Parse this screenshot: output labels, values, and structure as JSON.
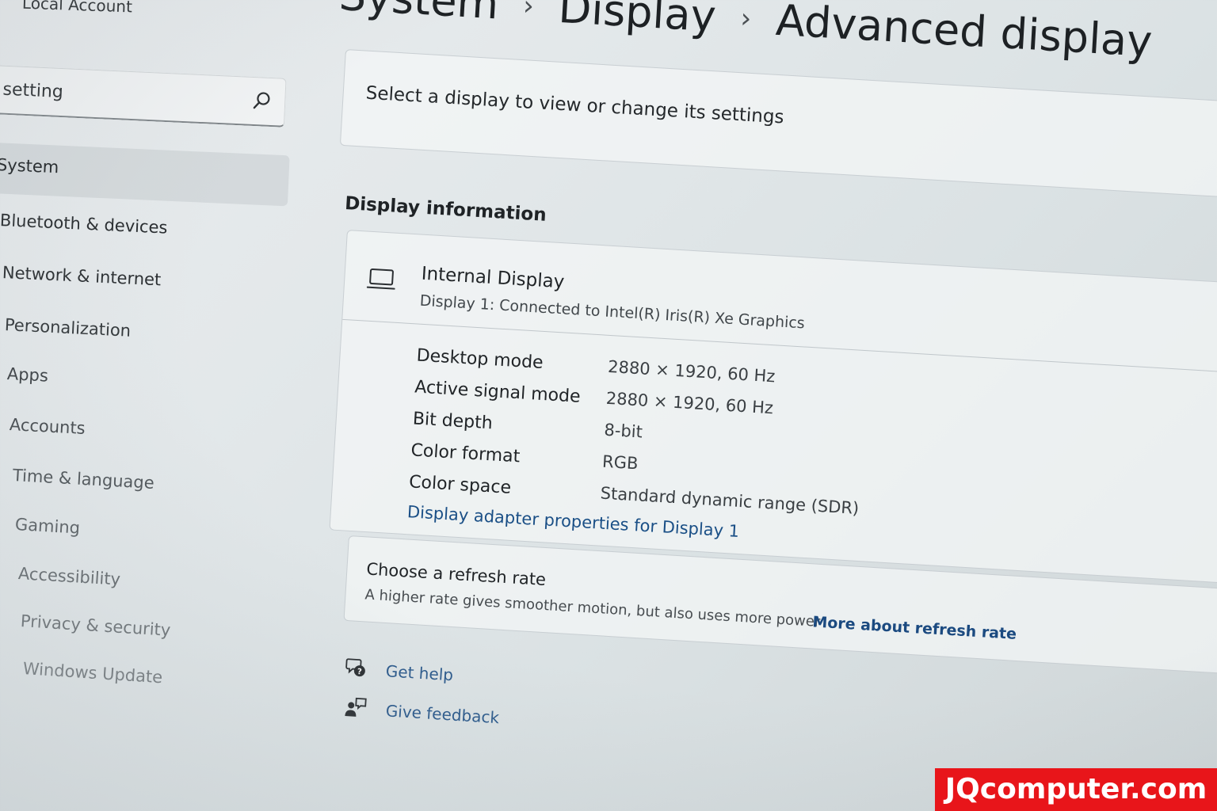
{
  "sidebar": {
    "account_label": "Local Account",
    "search": {
      "value": "setting",
      "icon": "search-icon"
    },
    "items": [
      {
        "label": "System"
      },
      {
        "label": "Bluetooth & devices"
      },
      {
        "label": "Network & internet"
      },
      {
        "label": "Personalization"
      },
      {
        "label": "Apps"
      },
      {
        "label": "Accounts"
      },
      {
        "label": "Time & language"
      },
      {
        "label": "Gaming"
      },
      {
        "label": "Accessibility"
      },
      {
        "label": "Privacy & security"
      },
      {
        "label": "Windows Update"
      }
    ]
  },
  "breadcrumb": {
    "items": [
      "System",
      "Display"
    ],
    "current": "Advanced display",
    "separator": "›"
  },
  "select_display": {
    "prompt": "Select a display to view or change its settings"
  },
  "display_information": {
    "heading": "Display information",
    "icon": "laptop-icon",
    "display_name": "Internal Display",
    "display_subtitle": "Display 1: Connected to Intel(R) Iris(R) Xe Graphics",
    "properties": [
      {
        "label": "Desktop mode",
        "value": "2880 × 1920, 60 Hz"
      },
      {
        "label": "Active signal mode",
        "value": "2880 × 1920, 60 Hz"
      },
      {
        "label": "Bit depth",
        "value": "8-bit"
      },
      {
        "label": "Color format",
        "value": "RGB"
      },
      {
        "label": "Color space",
        "value": "Standard dynamic range (SDR)"
      }
    ],
    "adapter_link": "Display adapter properties for Display 1"
  },
  "refresh_rate": {
    "title": "Choose a refresh rate",
    "description": "A higher rate gives smoother motion, but also uses more power",
    "more_link": "More about refresh rate"
  },
  "help": {
    "get_help": "Get help",
    "give_feedback": "Give feedback"
  },
  "watermark": {
    "text": "JQcomputer.com",
    "color": "#e8151a"
  },
  "colors": {
    "link": "#1a4f86",
    "text": "#1f2326",
    "background": "#e3e8ea"
  }
}
